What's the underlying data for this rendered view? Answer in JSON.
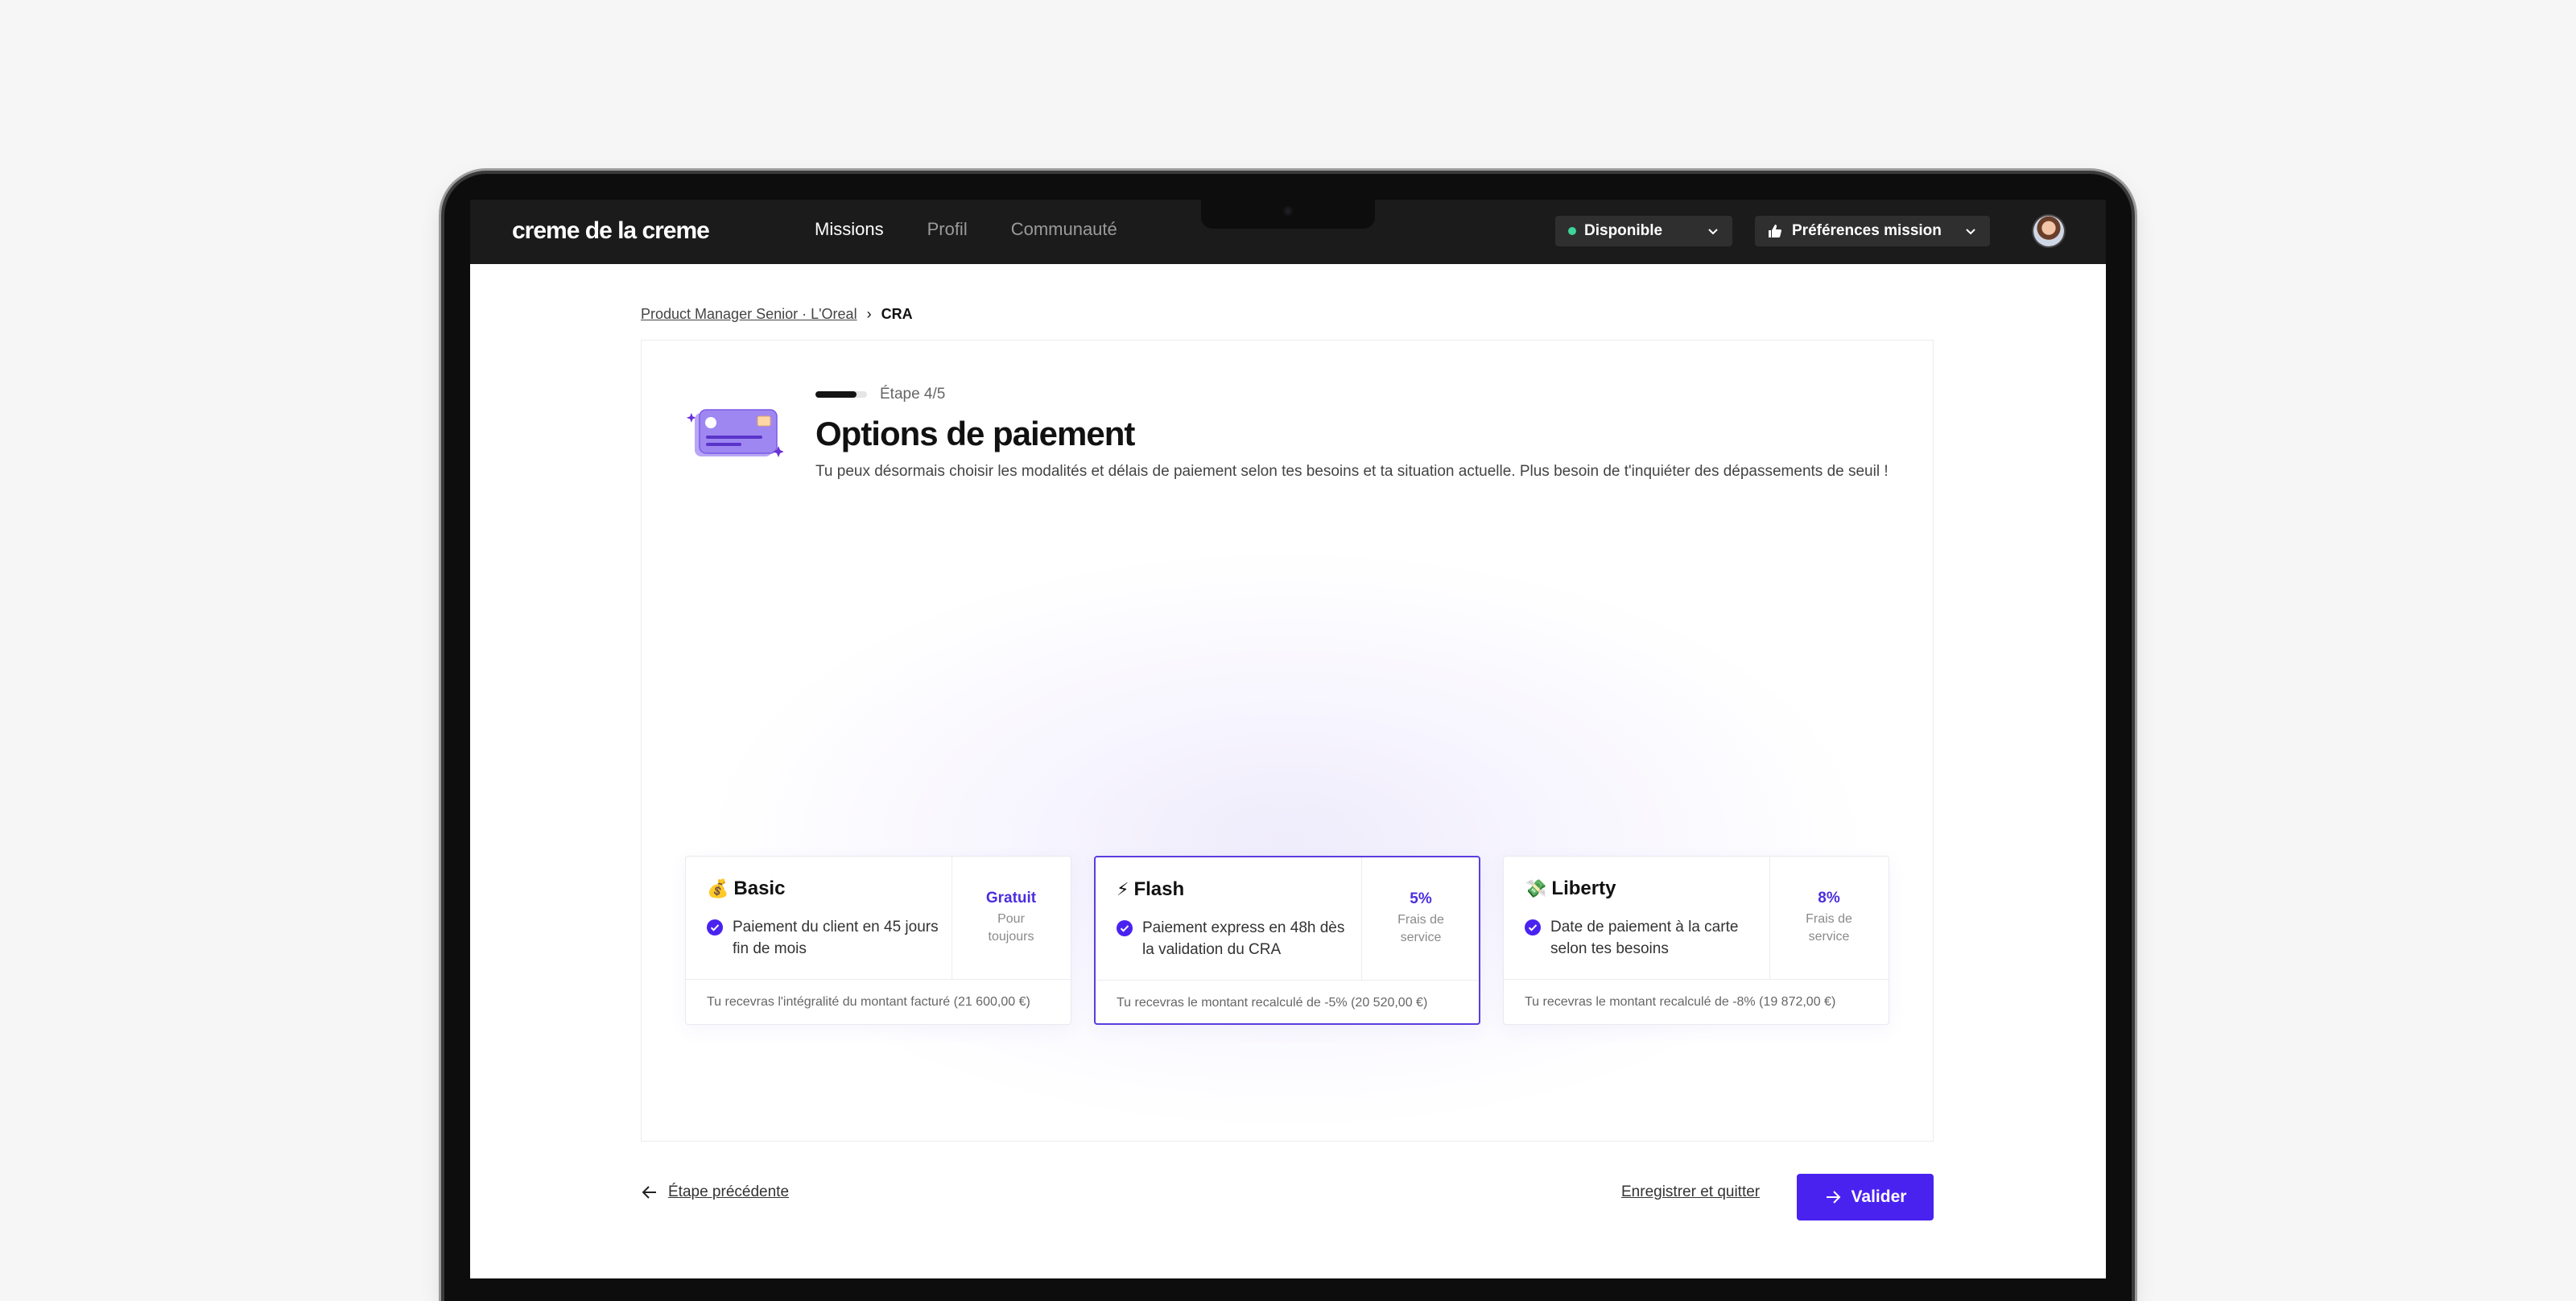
{
  "app": {
    "logo": "creme de la creme",
    "nav": [
      "Missions",
      "Profil",
      "Communauté"
    ],
    "status_label": "Disponible",
    "preferences_label": "Préférences mission",
    "colors": {
      "accent": "#4a22f0",
      "selected_border": "#5b3dde",
      "status_dot": "#3fd49a",
      "topbar": "#1b1b1b"
    }
  },
  "breadcrumb": {
    "parent": "Product Manager Senior · L'Oreal",
    "separator": "›",
    "current": "CRA"
  },
  "header": {
    "step_label": "Étape 4/5",
    "step_progress": 0.8,
    "title": "Options de paiement",
    "subtitle": "Tu peux désormais choisir les modalités et délais de paiement selon tes besoins et ta situation actuelle. Plus besoin de t'inquiéter des dépassements de seuil !"
  },
  "options": [
    {
      "emoji": "💰",
      "name": "Basic",
      "feature": "Paiement du client en 45 jours fin de mois",
      "price": "Gratuit",
      "price_sub": "Pour toujours",
      "footer": "Tu recevras l'intégralité du montant facturé (21 600,00 €)",
      "selected": false
    },
    {
      "emoji": "⚡",
      "name": "Flash",
      "feature": "Paiement express en 48h dès la validation du CRA",
      "price": "5%",
      "price_sub": "Frais de service",
      "footer": "Tu recevras le montant recalculé de -5% (20 520,00 €)",
      "selected": true
    },
    {
      "emoji": "💸",
      "name": "Liberty",
      "feature": "Date de paiement à la carte selon tes besoins",
      "price": "8%",
      "price_sub": "Frais de service",
      "footer": "Tu recevras le montant recalculé de -8% (19 872,00 €)",
      "selected": false
    }
  ],
  "actions": {
    "back": "Étape précédente",
    "save": "Enregistrer et quitter",
    "validate": "Valider"
  }
}
